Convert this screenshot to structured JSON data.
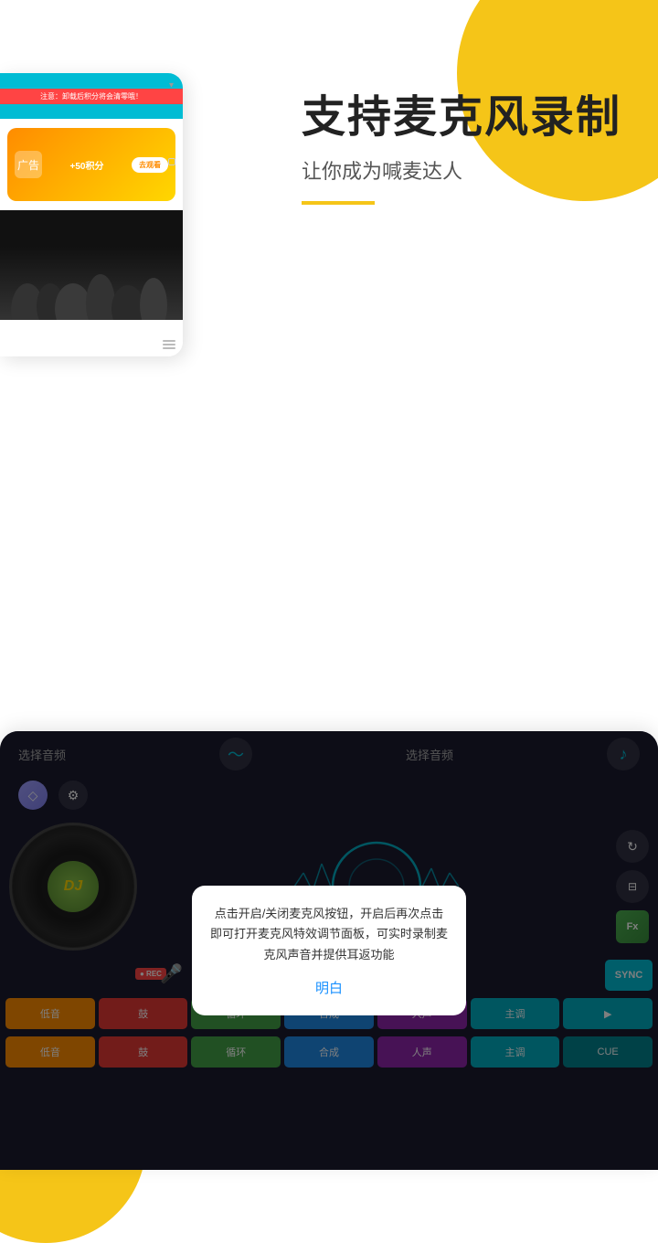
{
  "background": {
    "top_circle_color": "#F5C518",
    "bottom_circle_color": "#F5C518"
  },
  "top_section": {
    "main_title": "支持麦克风录制",
    "sub_title": "让你成为喊麦达人",
    "accent_line_color": "#F5C518"
  },
  "top_device": {
    "warning_text": "注意：卸载后积分将会清零哦！",
    "ad_text": "广告",
    "points_text": "+50积分",
    "watch_btn": "去观看"
  },
  "dj_section": {
    "toolbar": {
      "left_label": "选择音频",
      "right_label": "选择音频"
    },
    "vinyl_label": "DJ",
    "modal": {
      "text": "点击开启/关闭麦克风按钮，开启后再次点击即可打开麦克风特效调节面板，可实时录制麦克风声音并提供耳返功能",
      "confirm_btn": "明白"
    },
    "sync_btn": "SYNC",
    "rec_badge": "● REC",
    "buttons_row1": [
      {
        "label": "低音",
        "color": "btn-orange"
      },
      {
        "label": "鼓",
        "color": "btn-red"
      },
      {
        "label": "循环",
        "color": "btn-green"
      },
      {
        "label": "合成",
        "color": "btn-blue"
      },
      {
        "label": "人声",
        "color": "btn-purple"
      },
      {
        "label": "主调",
        "color": "btn-teal"
      },
      {
        "label": "▶",
        "color": "btn-play"
      }
    ],
    "buttons_row2": [
      {
        "label": "低音",
        "color": "btn-orange"
      },
      {
        "label": "鼓",
        "color": "btn-red"
      },
      {
        "label": "循环",
        "color": "btn-green"
      },
      {
        "label": "合成",
        "color": "btn-blue"
      },
      {
        "label": "人声",
        "color": "btn-purple"
      },
      {
        "label": "主调",
        "color": "btn-teal"
      },
      {
        "label": "CUE",
        "color": "btn-cue"
      }
    ]
  }
}
